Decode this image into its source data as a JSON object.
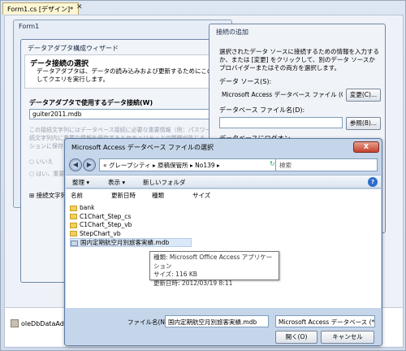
{
  "editor": {
    "tab_label": "Form1.cs [デザイン]*",
    "tab_close": "✕",
    "component_tray_item": "oleDbDataAdap"
  },
  "form1": {
    "title": "Form1"
  },
  "wizard": {
    "title": "データアダプタ構成ウィザード",
    "heading": "データ接続の選択",
    "description": "データアダプタは、データの読み込みおよび更新するためにこの接続",
    "description2": "してクエリを実行します。",
    "question": "データアダプタで使用するデータ接続(W)",
    "selected_connection": "guiter2011.mdb",
    "faint_text": "この接続文字列にはデータベース接続に必要な重要情報（例：パスワー",
    "faint_text2": "続文字列内に重要な情報を保存するとセキュリティ上の問題が生じる",
    "faint_text3": "ションに保存しますか？",
    "option_yes": "いいえ",
    "option_no": "はい、重要",
    "conn_string_label": "接続文字列"
  },
  "connection": {
    "title": "接続の追加",
    "description": "選択されたデータ ソースに接続するための情報を入力するか、または [変更] をクリックして、別のデータ ソースかプロバイダーまたはその両方を選択します。",
    "data_source_label": "データ ソース(S):",
    "data_source_value": "Microsoft Access データベース ファイル (OLE",
    "change_button": "変更(C)...",
    "db_file_label": "データベース ファイル名(D):",
    "db_file_value": "",
    "browse_button": "参照(B)...",
    "logon_label": "データベースにログオン"
  },
  "file_dialog": {
    "title": "Microsoft Access データベース ファイルの選択",
    "close": "X",
    "back": "◀",
    "forward": "▶",
    "address": "«  グレープシティ ▸ 原稿保管所 ▸ No139 ▸",
    "refresh_icon": "↻",
    "search_placeholder": "検索",
    "toolbar": {
      "organize": "整理 ▾",
      "views": "表示 ▾",
      "new_folder": "新しいフォルダ",
      "help": "?"
    },
    "columns": [
      "名前",
      "更新日時",
      "種類",
      "サイズ"
    ],
    "items": [
      {
        "type": "folder",
        "name": "bank"
      },
      {
        "type": "folder",
        "name": "C1Chart_Step_cs"
      },
      {
        "type": "folder",
        "name": "C1Chart_Step_vb"
      },
      {
        "type": "folder",
        "name": "StepChart_vb"
      },
      {
        "type": "mdb",
        "name": "国内定期航空月別旅客実績.mdb"
      }
    ],
    "tooltip": {
      "line1": "種類: Microsoft Office Access アプリケーション",
      "line2": "サイズ: 116 KB",
      "line3": "更新日時: 2012/03/19 8:11"
    },
    "filename_label": "ファイル名(N):",
    "filename_value": "国内定期航空月別旅客実績.mdb",
    "filetype_value": "Microsoft Access データベース (*",
    "open_button": "開く(O)",
    "cancel_button": "キャンセル"
  }
}
